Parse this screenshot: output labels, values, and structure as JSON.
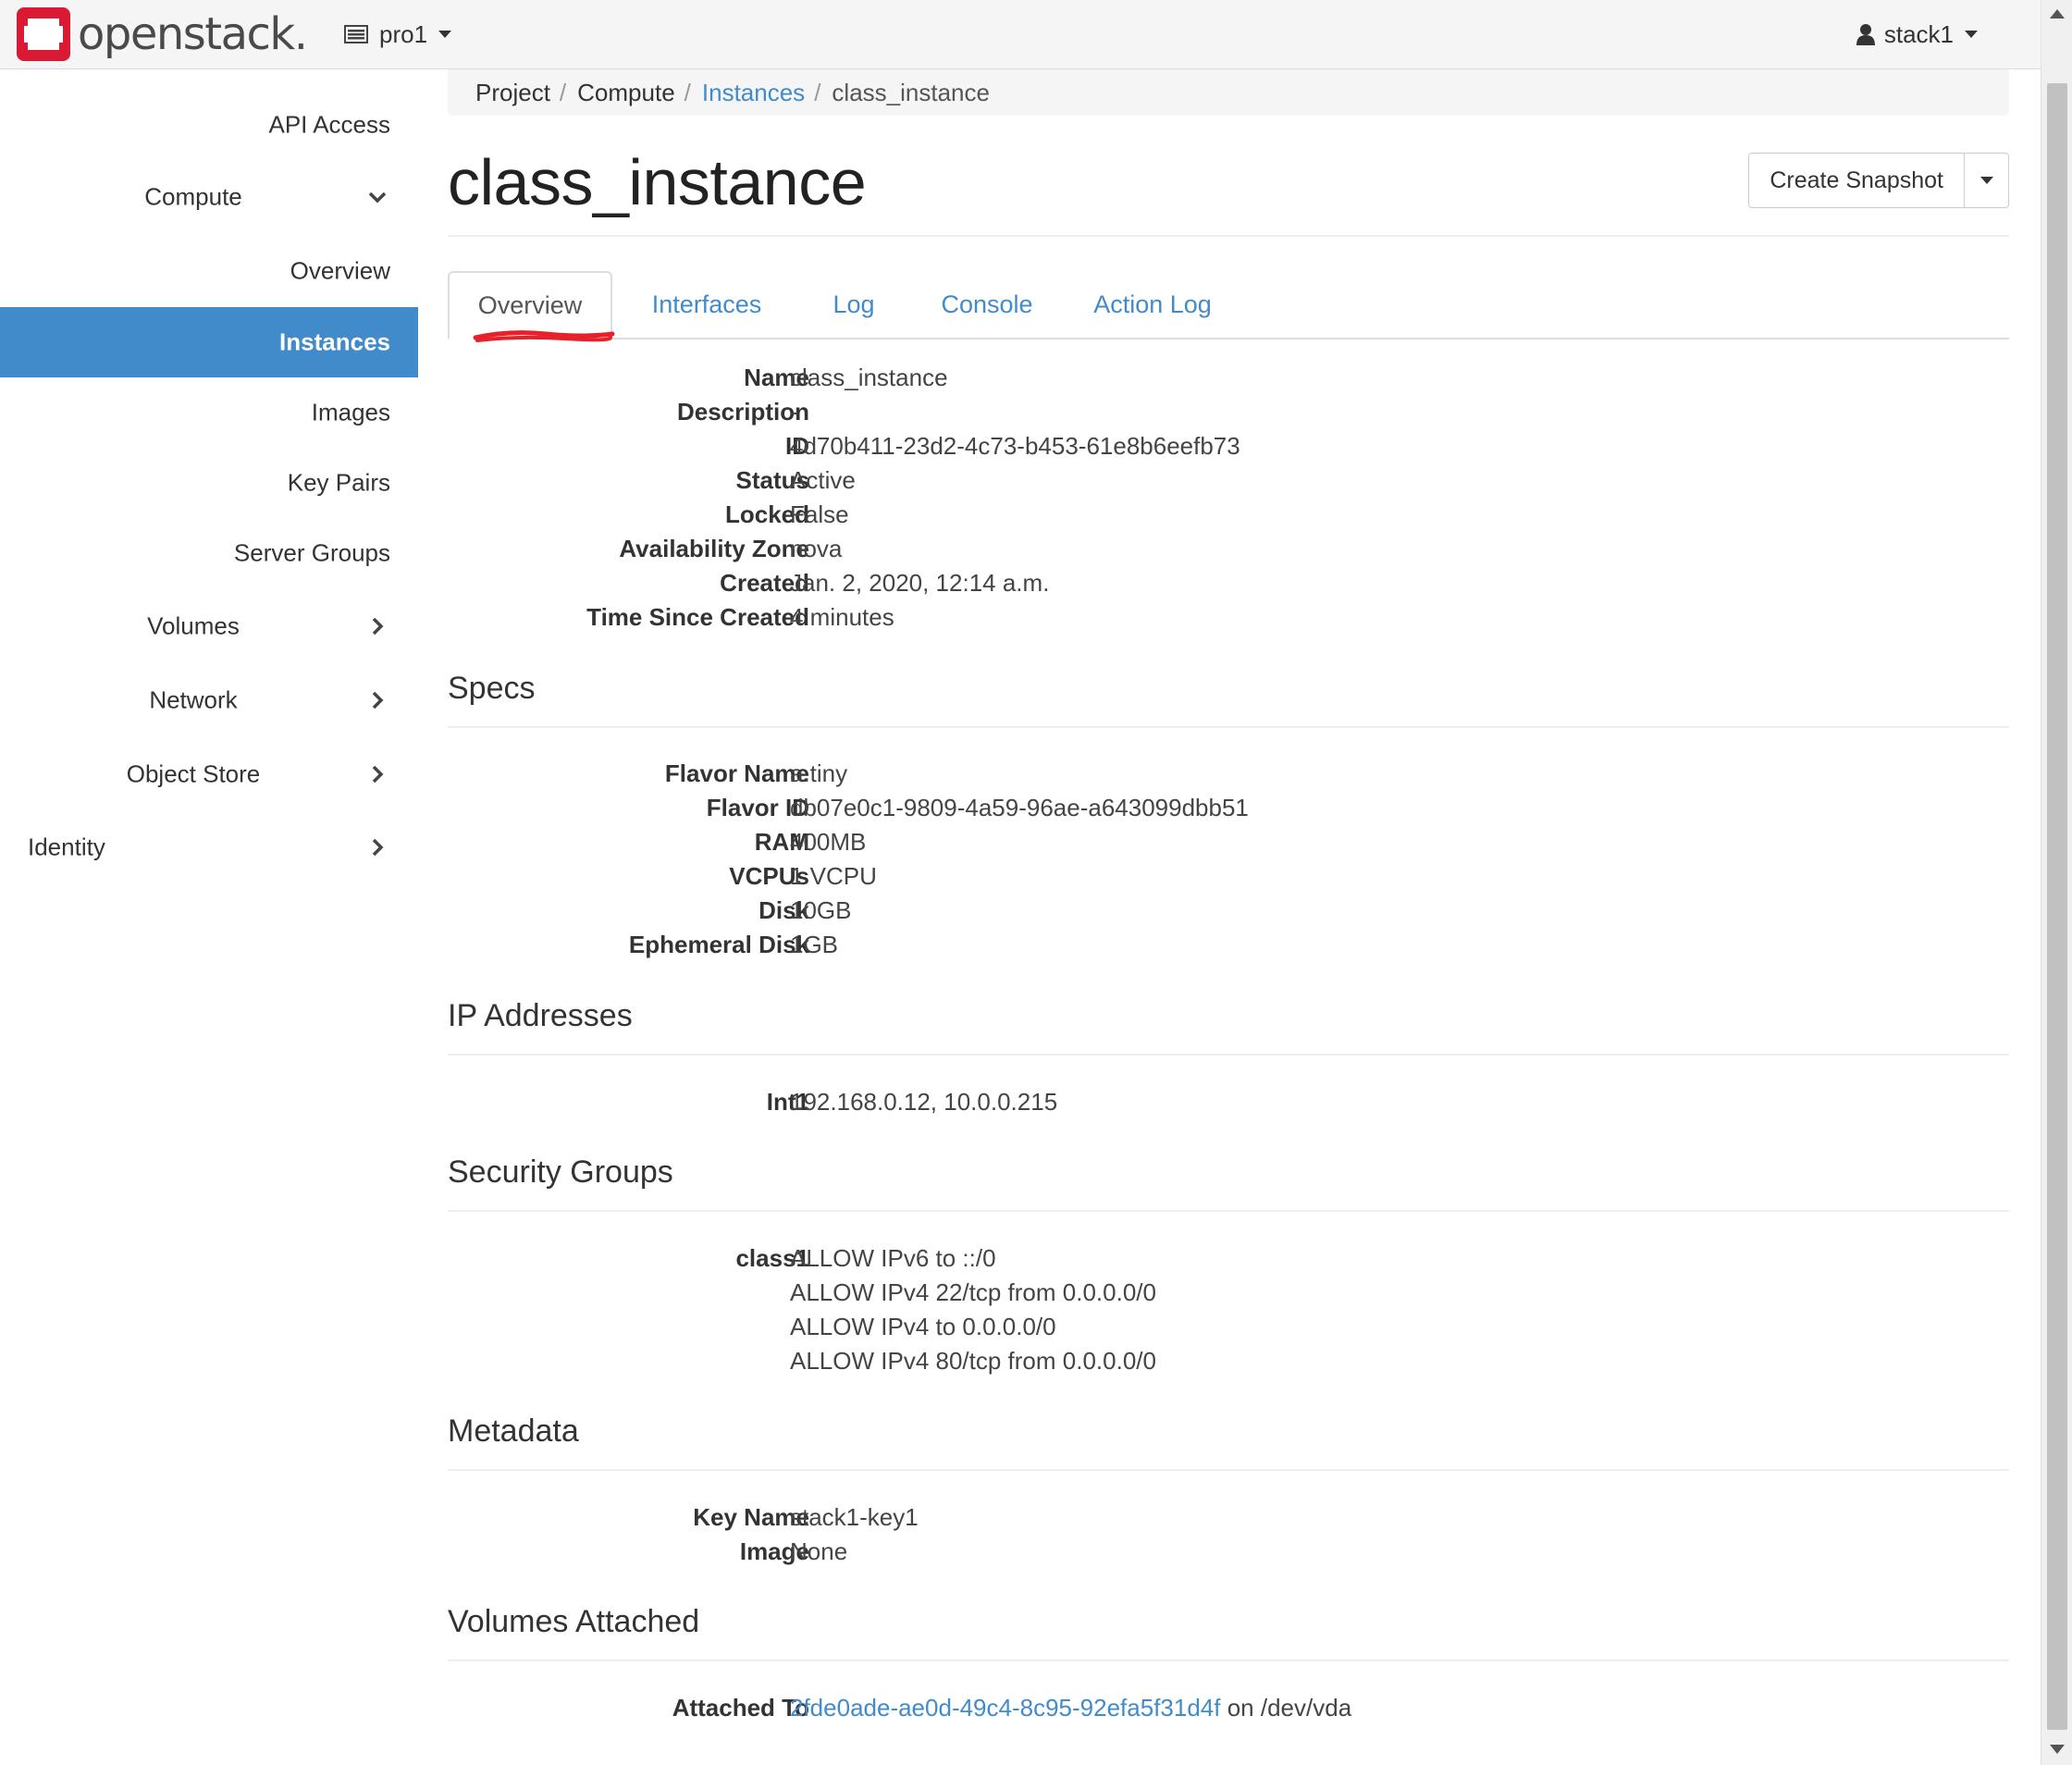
{
  "navbar": {
    "brand": "openstack.",
    "project": "pro1",
    "user": "stack1"
  },
  "sidebar": {
    "api_access": "API Access",
    "compute": "Compute",
    "overview": "Overview",
    "instances": "Instances",
    "images": "Images",
    "key_pairs": "Key Pairs",
    "server_groups": "Server Groups",
    "volumes": "Volumes",
    "network": "Network",
    "object_store": "Object Store",
    "identity": "Identity"
  },
  "breadcrumb": {
    "project": "Project",
    "compute": "Compute",
    "instances": "Instances",
    "current": "class_instance",
    "sep": "/"
  },
  "page": {
    "title": "class_instance",
    "create_snapshot": "Create Snapshot"
  },
  "tabs": {
    "overview": "Overview",
    "interfaces": "Interfaces",
    "log": "Log",
    "console": "Console",
    "action_log": "Action Log"
  },
  "overview": {
    "name_k": "Name",
    "name_v": "class_instance",
    "description_k": "Description",
    "description_v": "-",
    "id_k": "ID",
    "id_v": "4d70b411-23d2-4c73-b453-61e8b6eefb73",
    "status_k": "Status",
    "status_v": "Active",
    "locked_k": "Locked",
    "locked_v": "False",
    "az_k": "Availability Zone",
    "az_v": "nova",
    "created_k": "Created",
    "created_v": "Jan. 2, 2020, 12:14 a.m.",
    "since_k": "Time Since Created",
    "since_v": "4 minutes"
  },
  "specs": {
    "title": "Specs",
    "flavor_name_k": "Flavor Name",
    "flavor_name_v": "a.tiny",
    "flavor_id_k": "Flavor ID",
    "flavor_id_v": "db07e0c1-9809-4a59-96ae-a643099dbb51",
    "ram_k": "RAM",
    "ram_v": "400MB",
    "vcpus_k": "VCPUs",
    "vcpus_v": "1 VCPU",
    "disk_k": "Disk",
    "disk_v": "10GB",
    "eph_k": "Ephemeral Disk",
    "eph_v": "1GB"
  },
  "ip": {
    "title": "IP Addresses",
    "net_k": "Int1",
    "net_v": "192.168.0.12,  10.0.0.215"
  },
  "security": {
    "title": "Security Groups",
    "group_k": "class1",
    "rules": [
      "ALLOW IPv6 to ::/0",
      "ALLOW IPv4 22/tcp from 0.0.0.0/0",
      "ALLOW IPv4 to 0.0.0.0/0",
      "ALLOW IPv4 80/tcp from 0.0.0.0/0"
    ]
  },
  "metadata": {
    "title": "Metadata",
    "key_name_k": "Key Name",
    "key_name_v": "stack1-key1",
    "image_k": "Image",
    "image_v": "None"
  },
  "volumes": {
    "title": "Volumes Attached",
    "attached_k": "Attached To",
    "volume_link": "2fde0ade-ae0d-49c4-8c95-92efa5f31d4f",
    "mount": " on /dev/vda"
  },
  "colors": {
    "accent": "#428bca",
    "brand_red": "#da1a32",
    "annotation_red": "#e8202a"
  },
  "icons": {
    "logo": "openstack-logo-icon",
    "project": "project-list-icon",
    "user": "user-icon",
    "chevron_down": "chevron-down-icon",
    "chevron_right": "chevron-right-icon",
    "caret": "caret-down-icon"
  }
}
